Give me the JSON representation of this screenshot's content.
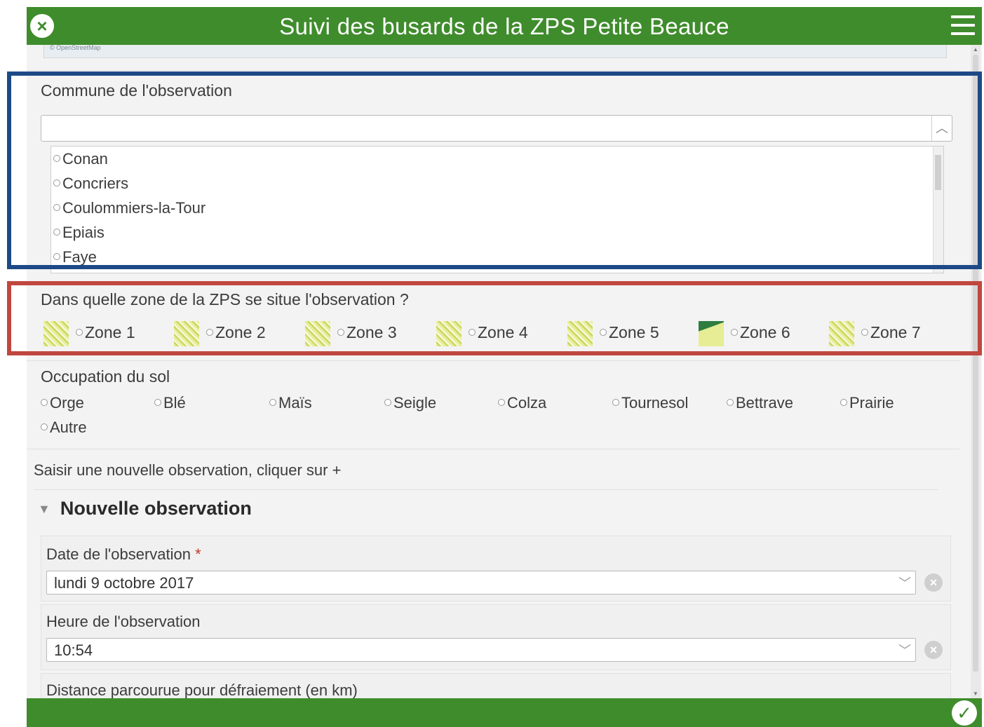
{
  "header": {
    "title": "Suivi des busards de la ZPS Petite Beauce",
    "close_icon": "close-icon",
    "menu_icon": "hamburger-menu-icon",
    "color": "#3f8c2c"
  },
  "map": {
    "attribution": "© OpenStreetMap"
  },
  "commune": {
    "label": "Commune de l'observation",
    "input_value": "",
    "options": [
      "Conan",
      "Concriers",
      "Coulommiers-la-Tour",
      "Epiais",
      "Faye"
    ]
  },
  "zone": {
    "label": "Dans quelle zone de la ZPS se situe l'observation ?",
    "options": [
      "Zone 1",
      "Zone 2",
      "Zone 3",
      "Zone 4",
      "Zone 5",
      "Zone 6",
      "Zone 7"
    ]
  },
  "occupation": {
    "label": "Occupation du sol",
    "options": [
      "Orge",
      "Blé",
      "Maïs",
      "Seigle",
      "Colza",
      "Tournesol",
      "Bettrave",
      "Prairie",
      "Autre"
    ]
  },
  "new_obs_hint": "Saisir une nouvelle observation, cliquer sur +",
  "new_observation": {
    "title": "Nouvelle observation",
    "date_label": "Date de l'observation",
    "date_required": "*",
    "date_value": "lundi 9 octobre 2017",
    "time_label": "Heure de l'observation",
    "time_value": "10:54",
    "distance_label": "Distance parcourue pour défraiement (en km)"
  },
  "footer": {
    "submit_icon": "checkmark-icon"
  },
  "highlight_colors": {
    "commune_box": "#1d4a86",
    "zone_box": "#c0473f"
  }
}
